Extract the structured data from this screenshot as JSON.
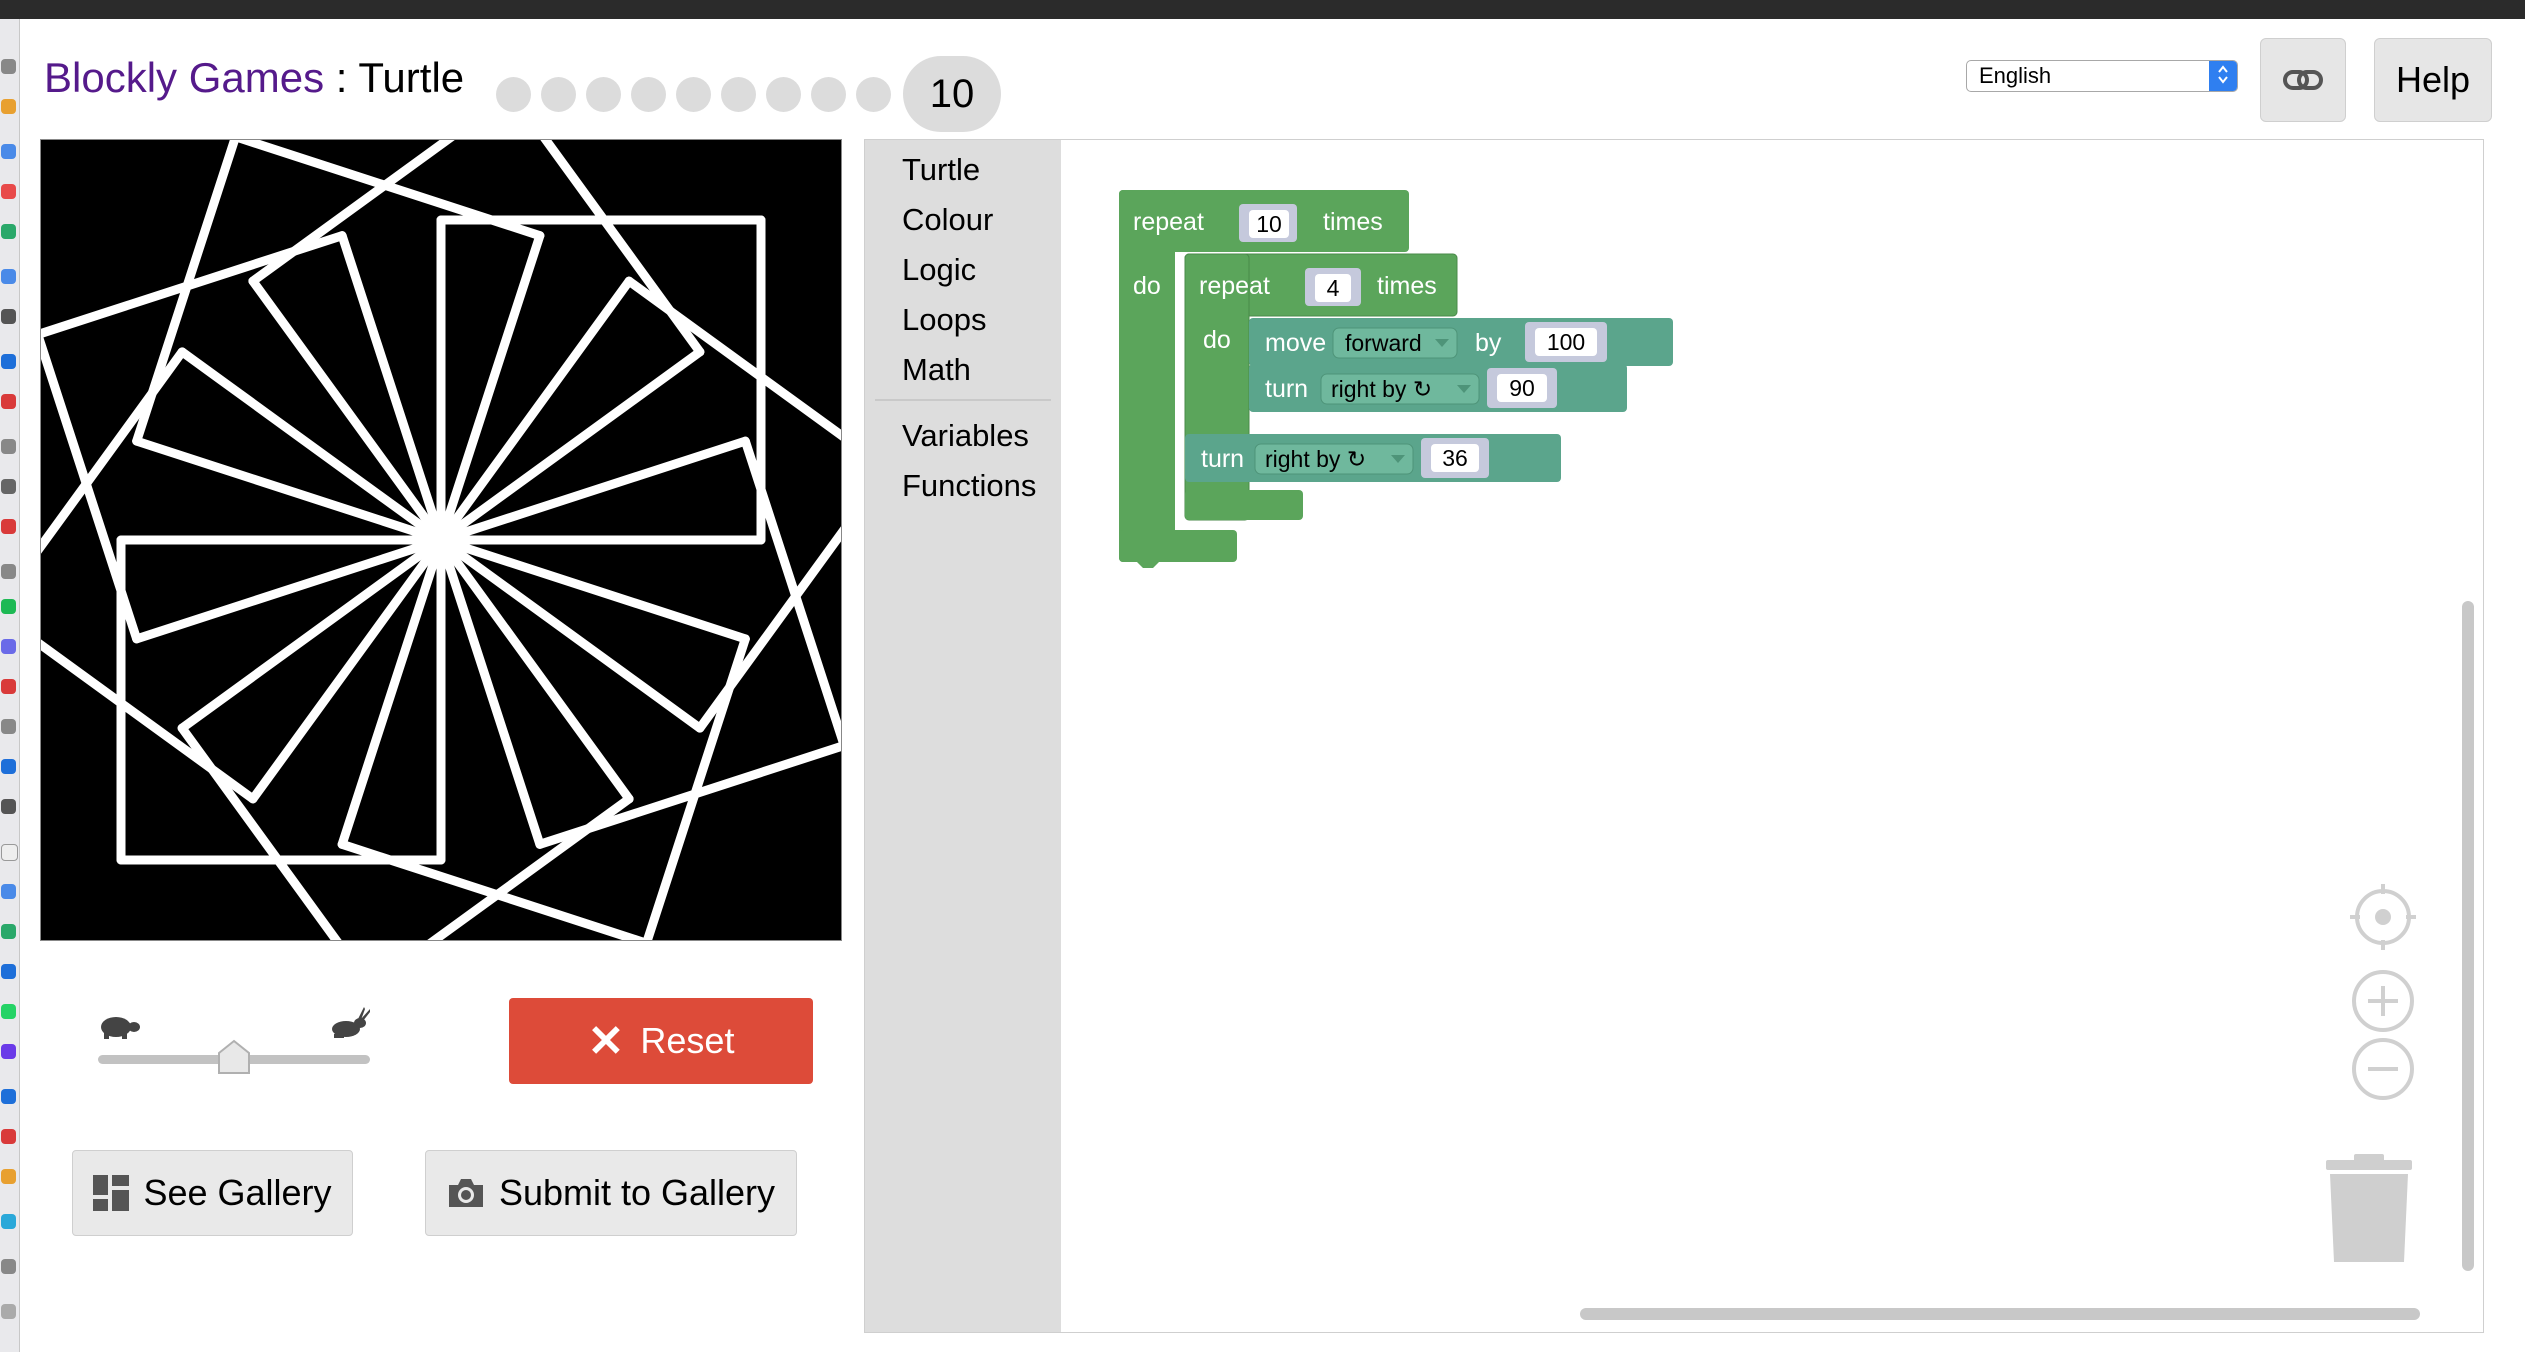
{
  "header": {
    "app_name": "Blockly Games",
    "separator": " : ",
    "game_name": "Turtle",
    "levels": [
      "1",
      "2",
      "3",
      "4",
      "5",
      "6",
      "7",
      "8",
      "9"
    ],
    "current_level": "10"
  },
  "language_select": {
    "value": "English"
  },
  "help_button": {
    "label": "Help"
  },
  "controls": {
    "reset_label": "Reset",
    "see_gallery_label": "See Gallery",
    "submit_gallery_label": "Submit to Gallery",
    "speed_level": 0.5
  },
  "toolbox": {
    "items": [
      "Turtle",
      "Colour",
      "Logic",
      "Loops",
      "Math",
      "Variables",
      "Functions"
    ]
  },
  "blocks": {
    "outer_repeat": {
      "label": "repeat",
      "count": "10",
      "suffix": "times",
      "do_label": "do"
    },
    "inner_repeat": {
      "label": "repeat",
      "count": "4",
      "suffix": "times",
      "do_label": "do"
    },
    "move": {
      "label": "move",
      "direction": "forward",
      "by_label": "by",
      "amount": "100"
    },
    "turn_inner": {
      "label": "turn",
      "direction": "right by ↻",
      "amount": "90"
    },
    "turn_outer": {
      "label": "turn",
      "direction": "right by ↻",
      "amount": "36"
    }
  },
  "colors": {
    "loops_block": "#5ba55b",
    "turtle_block": "#5ba58c",
    "number_slot": "#c5c9dc",
    "reset": "#dd4b39",
    "title": "#551a8b"
  }
}
